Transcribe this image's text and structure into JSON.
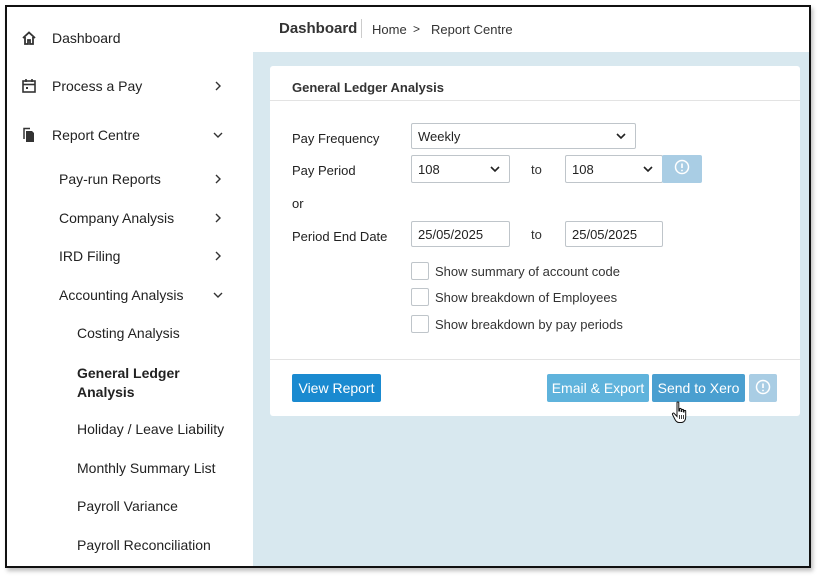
{
  "sidebar": {
    "items": [
      {
        "label": "Dashboard",
        "icon": "home-icon"
      },
      {
        "label": "Process a Pay",
        "icon": "calendar-icon"
      },
      {
        "label": "Report Centre",
        "icon": "documents-icon"
      }
    ],
    "report_centre_children": [
      {
        "label": "Pay-run Reports"
      },
      {
        "label": "Company Analysis"
      },
      {
        "label": "IRD Filing"
      },
      {
        "label": "Accounting Analysis"
      }
    ],
    "accounting_children": [
      {
        "label": "Costing Analysis"
      },
      {
        "label": "General Ledger Analysis",
        "active": true
      },
      {
        "label": "Holiday / Leave Liability"
      },
      {
        "label": "Monthly Summary List"
      },
      {
        "label": "Payroll Variance"
      },
      {
        "label": "Payroll Reconciliation"
      }
    ]
  },
  "header": {
    "title": "Dashboard",
    "breadcrumb": [
      "Home",
      "Report Centre"
    ],
    "breadcrumb_separator": ">"
  },
  "form": {
    "title": "General Ledger Analysis",
    "pay_frequency_label": "Pay Frequency",
    "pay_frequency_value": "Weekly",
    "pay_period_label": "Pay Period",
    "pay_period_from": "108",
    "pay_period_to": "108",
    "to_label": "to",
    "or_label": "or",
    "period_end_label": "Period End Date",
    "period_end_from": "25/05/2025",
    "period_end_to": "25/05/2025",
    "checkboxes": [
      {
        "label": "Show summary of account code",
        "checked": false
      },
      {
        "label": "Show breakdown of Employees",
        "checked": false
      },
      {
        "label": "Show breakdown by pay periods",
        "checked": false
      }
    ]
  },
  "actions": {
    "view_report": "View Report",
    "email_export": "Email & Export",
    "send_to_xero": "Send to Xero"
  },
  "colors": {
    "primary": "#1a8ad0",
    "background": "#d8e8ef",
    "disabled": "#a9cde4"
  }
}
